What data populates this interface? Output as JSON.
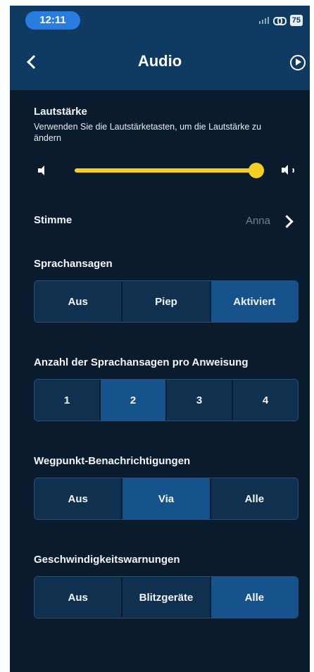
{
  "status_bar": {
    "time": "12:11",
    "battery": "75"
  },
  "header": {
    "title": "Audio"
  },
  "volume": {
    "title": "Lautstärke",
    "subtitle": "Verwenden Sie die Lautstärketasten, um die Lautstärke zu ändern",
    "level_percent": 100
  },
  "voice": {
    "label": "Stimme",
    "value": "Anna"
  },
  "announcements": {
    "title": "Sprachansagen",
    "options": [
      "Aus",
      "Piep",
      "Aktiviert"
    ],
    "selected": "Aktiviert"
  },
  "announcement_count": {
    "title": "Anzahl der Sprachansagen pro Anweisung",
    "options": [
      "1",
      "2",
      "3",
      "4"
    ],
    "selected": "2"
  },
  "waypoint_notifications": {
    "title": "Wegpunkt-Benachrichtigungen",
    "options": [
      "Aus",
      "Via",
      "Alle"
    ],
    "selected": "Via"
  },
  "speed_warnings": {
    "title": "Geschwindigkeitswarnungen",
    "options": [
      "Aus",
      "Blitzgeräte",
      "Alle"
    ],
    "selected": "Alle"
  },
  "colors": {
    "accent": "#f5d020",
    "selected_segment": "#16528c",
    "unselected_segment": "#10304f",
    "background": "#0a1b2d",
    "header": "#0f3b63"
  }
}
